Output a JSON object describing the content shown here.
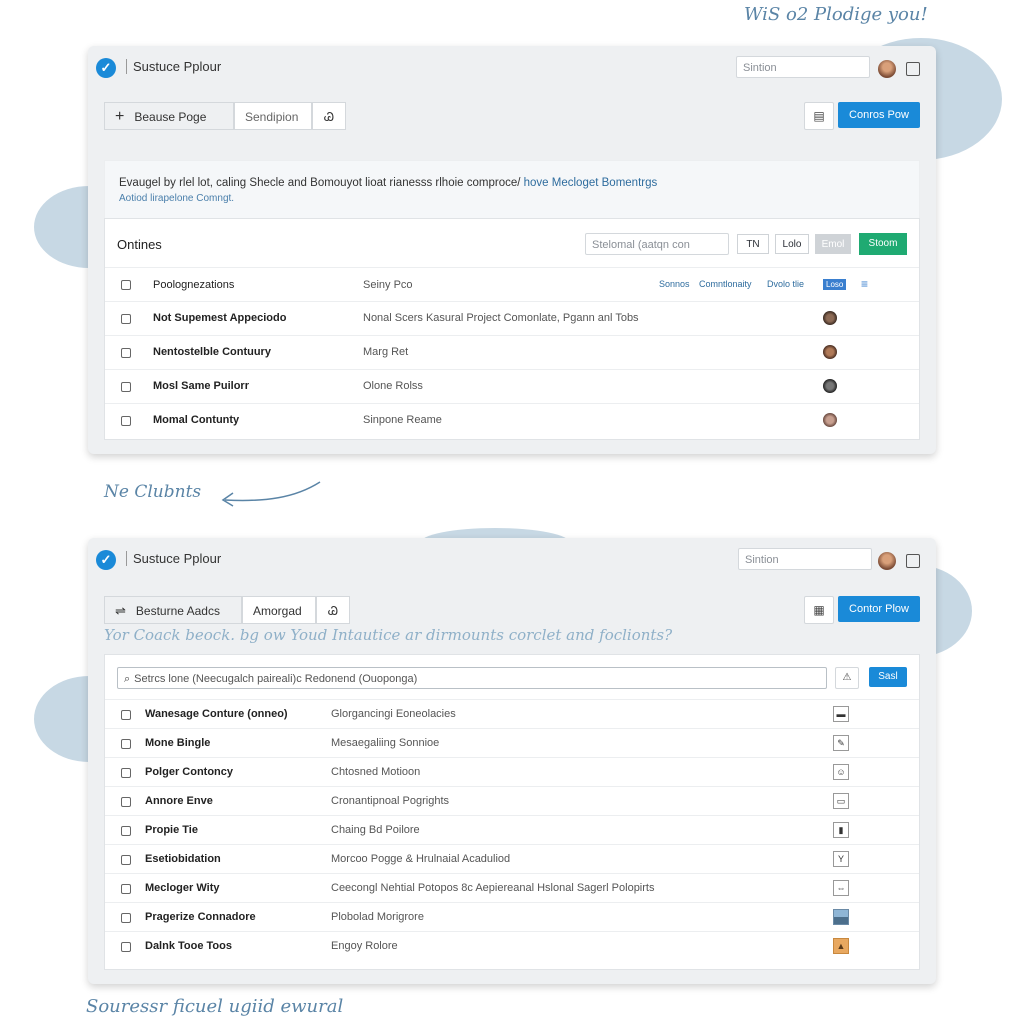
{
  "top_note": "WiS o2 Plodige you!",
  "middle_note": "Ne Clubnts",
  "bottom_note": "Souressr ficuel ugiid ewural",
  "panel1": {
    "app_title": "Sustuce Pplour",
    "search_placeholder": "Sintion",
    "tab1_label": "Beause Poge",
    "tab2_label": "Sendipion",
    "tab3_label": "Ꮚ",
    "primary_button": "Conros Pow",
    "info_line1": "Evaugel by rlel lot, caling Shecle and Bomouyot lioat rianesss rlhoie comproce/",
    "info_link1": "hove Mecloget Bomentrgs",
    "info_line2": "Aotiod lirapelone Comngt.",
    "section_title": "Ontines",
    "filter_placeholder": "Stelomal (aatqn con",
    "btn_tn": "TN",
    "btn_lolo": "Lolo",
    "btn_emol": "Emol",
    "btn_stoom": "Stoom",
    "header_links": [
      "Sonnos",
      "Comntlonaity",
      "Dvolo tlie"
    ],
    "header_badge": "Loso",
    "rows": [
      {
        "name": "Poolognezations",
        "desc": "Seiny Pco"
      },
      {
        "name": "Not Supemest Appeciodo",
        "desc": "Nonal Scers Kasural Project Comonlate, Pgann anl Tobs"
      },
      {
        "name": "Nentostelble Contuury",
        "desc": "Marg Ret"
      },
      {
        "name": "Mosl Same Puilorr",
        "desc": "Olone Rolss"
      },
      {
        "name": "Momal Contunty",
        "desc": "Sinpone Reame"
      }
    ]
  },
  "panel2": {
    "app_title": "Sustuce Pplour",
    "search_placeholder": "Sintion",
    "tab1_label": "Besturne Aadcs",
    "tab2_label": "Amorgad",
    "tab3_label": "Ꮚ",
    "primary_button": "Contor Plow",
    "hint_text": "Yor Coack beock. bg ow Youd Intautice ar dirmounts corclet and foclionts?",
    "search_value": "Setrcs lone (Neecugalch paireali)c Redonend (Ouoponga)",
    "search_button": "Sasl",
    "rows": [
      {
        "name": "Wanesage Conture (onneo)",
        "desc": "Glorgancingi Eoneolacies"
      },
      {
        "name": "Mone Bingle",
        "desc": "Mesaegaliing Sonnioe"
      },
      {
        "name": "Polger Contoncy",
        "desc": "Chtosned Motioon"
      },
      {
        "name": "Annore Enve",
        "desc": "Cronantipnoal Pogrights"
      },
      {
        "name": "Propie Tie",
        "desc": "Chaing Bd Poilore"
      },
      {
        "name": "Esetiobidation",
        "desc": "Morcoo Pogge & Hrulnaial Acaduliod"
      },
      {
        "name": "Mecloger Wity",
        "desc": "Ceecongl Nehtial Potopos 8c Aepiereanal Hslonal Sagerl Polopirts"
      },
      {
        "name": "Pragerize Connadore",
        "desc": "Plobolad Morigrore"
      },
      {
        "name": "Dalnk Tooe Toos",
        "desc": "Engoy Rolore"
      }
    ]
  }
}
